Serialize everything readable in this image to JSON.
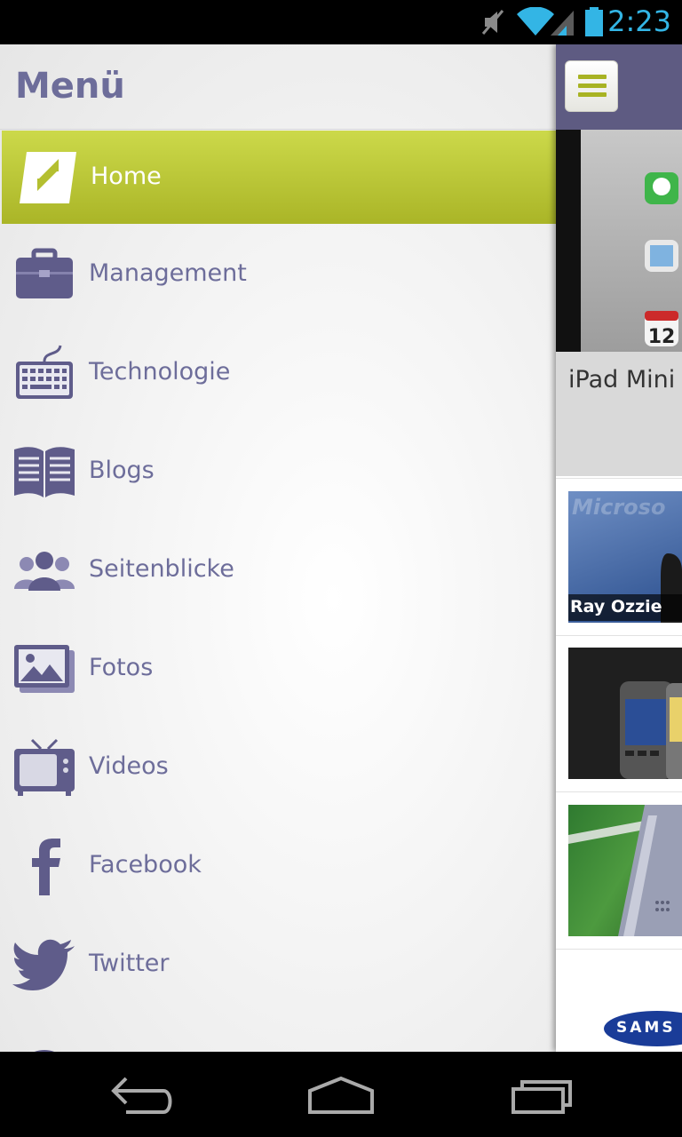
{
  "status_bar": {
    "time": "2:23",
    "icons": [
      "muted-icon",
      "wifi-icon",
      "signal-icon",
      "battery-icon"
    ],
    "accent_color": "#33b5e5"
  },
  "drawer": {
    "title": "Menü",
    "items": [
      {
        "label": "Home",
        "icon": "app-logo-icon",
        "active": true
      },
      {
        "label": "Management",
        "icon": "briefcase-icon",
        "active": false
      },
      {
        "label": "Technologie",
        "icon": "keyboard-icon",
        "active": false
      },
      {
        "label": "Blogs",
        "icon": "open-book-icon",
        "active": false
      },
      {
        "label": "Seitenblicke",
        "icon": "people-icon",
        "active": false
      },
      {
        "label": "Fotos",
        "icon": "photo-icon",
        "active": false
      },
      {
        "label": "Videos",
        "icon": "tv-icon",
        "active": false
      },
      {
        "label": "Facebook",
        "icon": "facebook-icon",
        "active": false
      },
      {
        "label": "Twitter",
        "icon": "twitter-icon",
        "active": false
      }
    ],
    "colors": {
      "accent": "#b4bf30",
      "text": "#6d6d9a"
    }
  },
  "content": {
    "header_color": "#5e5b82",
    "featured": {
      "title": "iPad Mini",
      "calendar_day": "12"
    },
    "articles": [
      {
        "caption": "Ray Ozzie",
        "logo_text": "Microso"
      },
      {
        "caption": ""
      },
      {
        "caption": ""
      },
      {
        "logo_text": "SAMS"
      }
    ]
  },
  "nav_bar": {
    "buttons": [
      "back-icon",
      "home-icon",
      "recent-apps-icon"
    ]
  }
}
